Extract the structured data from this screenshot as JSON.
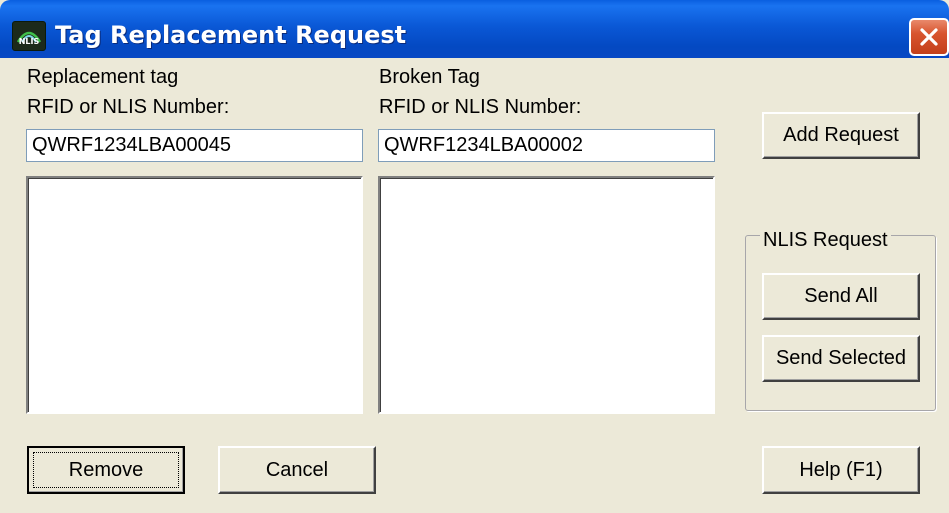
{
  "window": {
    "title": "Tag Replacement Request",
    "app_icon": "nlis-app-icon",
    "close_icon": "close-icon"
  },
  "replacement": {
    "label_line1": "Replacement tag",
    "label_line2": "RFID or NLIS Number:",
    "value": "QWRF1234LBA00045",
    "items": []
  },
  "broken": {
    "label_line1": "Broken Tag",
    "label_line2": "RFID or NLIS Number:",
    "value": "QWRF1234LBA00002",
    "items": []
  },
  "buttons": {
    "add_request": "Add Request",
    "remove": "Remove",
    "cancel": "Cancel",
    "help": "Help (F1)"
  },
  "nlis_request": {
    "legend": "NLIS Request",
    "send_all": "Send All",
    "send_selected": "Send Selected"
  },
  "colors": {
    "titlebar": "#0a58d6",
    "dialog_face": "#ece9d8",
    "close_button": "#d8552f"
  }
}
